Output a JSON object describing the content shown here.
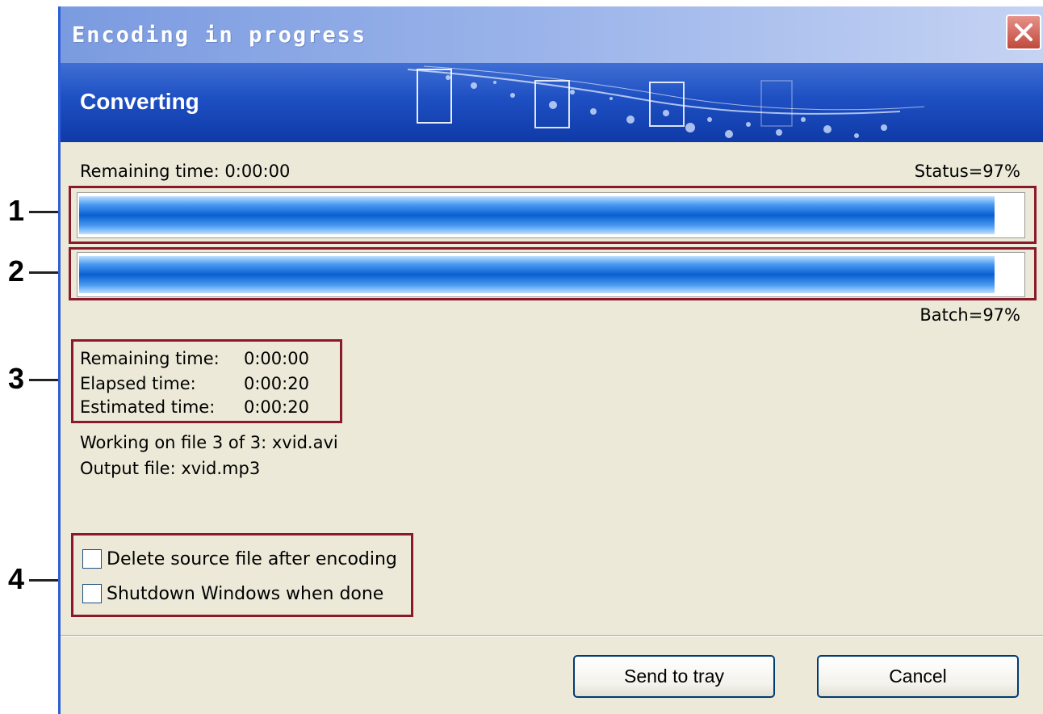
{
  "window": {
    "title": "Encoding in progress",
    "banner_title": "Converting"
  },
  "progress": {
    "remaining_label": "Remaining time: 0:00:00",
    "status_label": "Status=97%",
    "batch_label": "Batch=97%",
    "status_fraction": 0.97,
    "batch_fraction": 0.97
  },
  "stats": [
    {
      "label": "Remaining time:",
      "value": "0:00:00"
    },
    {
      "label": "Elapsed time:",
      "value": "0:00:20"
    },
    {
      "label": "Estimated time:",
      "value": "0:00:20"
    }
  ],
  "info": {
    "working_on": "Working on file 3 of 3: xvid.avi",
    "output_file": "Output file: xvid.mp3"
  },
  "options": {
    "delete_source": {
      "label": "Delete source file after encoding",
      "checked": false
    },
    "shutdown": {
      "label": "Shutdown Windows when done",
      "checked": false
    }
  },
  "buttons": {
    "send_to_tray": "Send to tray",
    "cancel": "Cancel"
  },
  "annotations": [
    "1",
    "2",
    "3",
    "4"
  ],
  "colors": {
    "annotation_border": "#8a1a2a",
    "progress_fill": "#0a5fd0",
    "titlebar": "#7b9be0",
    "banner": "#1e4fc2"
  }
}
